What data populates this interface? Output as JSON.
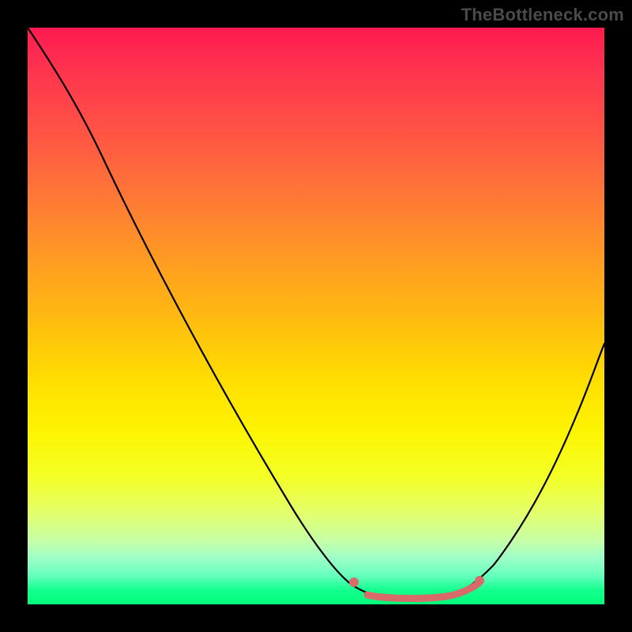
{
  "watermark": "TheBottleneck.com",
  "colors": {
    "background": "#000000",
    "curve": "#000000",
    "marker": "#d96a6a"
  },
  "chart_data": {
    "type": "line",
    "title": "",
    "xlabel": "",
    "ylabel": "",
    "xlim": [
      0,
      1
    ],
    "ylim": [
      0,
      1
    ],
    "series": [
      {
        "name": "bottleneck-curve",
        "x": [
          0.0,
          0.05,
          0.1,
          0.15,
          0.2,
          0.25,
          0.3,
          0.35,
          0.4,
          0.45,
          0.5,
          0.535,
          0.57,
          0.6,
          0.63,
          0.66,
          0.69,
          0.72,
          0.75,
          0.78,
          0.81,
          0.84,
          0.87,
          0.9,
          0.93,
          0.965,
          1.0
        ],
        "y": [
          1.0,
          0.92,
          0.83,
          0.74,
          0.65,
          0.56,
          0.47,
          0.38,
          0.29,
          0.2,
          0.12,
          0.075,
          0.045,
          0.028,
          0.018,
          0.013,
          0.01,
          0.01,
          0.012,
          0.02,
          0.035,
          0.06,
          0.095,
          0.145,
          0.21,
          0.3,
          0.41
        ]
      }
    ],
    "markers": {
      "name": "bottom-highlight",
      "color": "#d96a6a",
      "points_x": [
        0.57,
        0.73
      ],
      "points_y": [
        0.05,
        0.05
      ],
      "strip_x": [
        0.6,
        0.66,
        0.72
      ],
      "strip_y": [
        0.02,
        0.012,
        0.012
      ]
    }
  }
}
